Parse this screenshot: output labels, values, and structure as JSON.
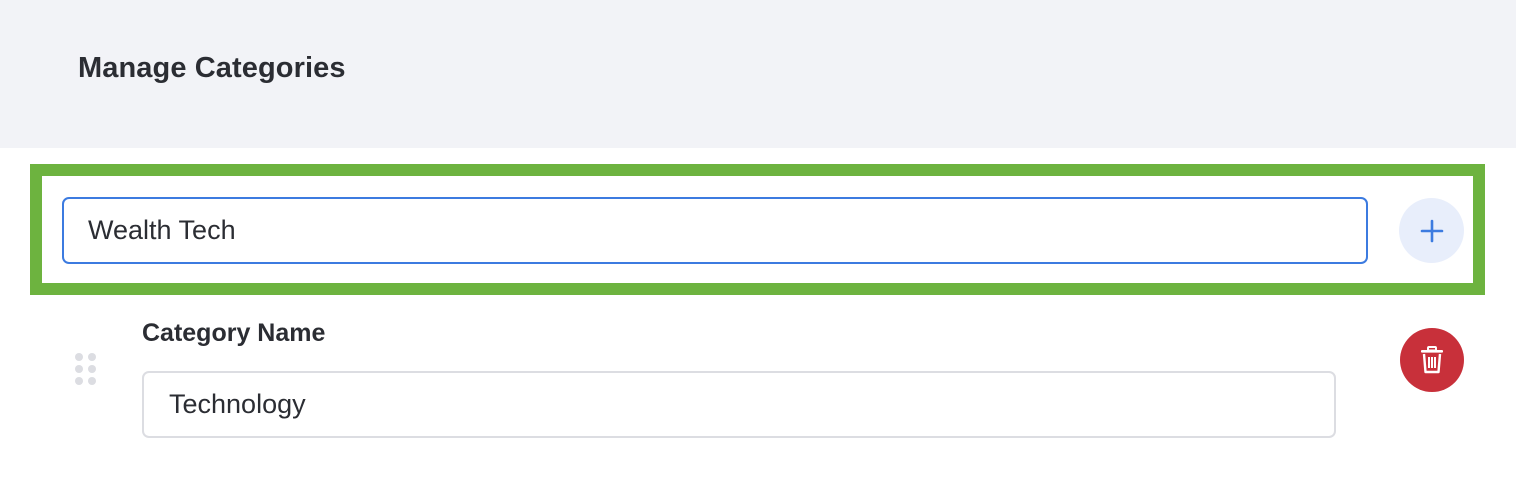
{
  "header": {
    "title": "Manage Categories"
  },
  "new_category": {
    "value": "Wealth Tech",
    "add_icon": "plus-icon"
  },
  "categories": [
    {
      "label": "Category Name",
      "value": "Technology",
      "drag_icon": "drag-handle-icon",
      "delete_icon": "trash-icon"
    }
  ],
  "colors": {
    "highlight": "#6db33f",
    "accent": "#3c7be0",
    "add_button_bg": "#e8eefb",
    "danger": "#c8303a",
    "header_bg": "#f2f3f7"
  }
}
